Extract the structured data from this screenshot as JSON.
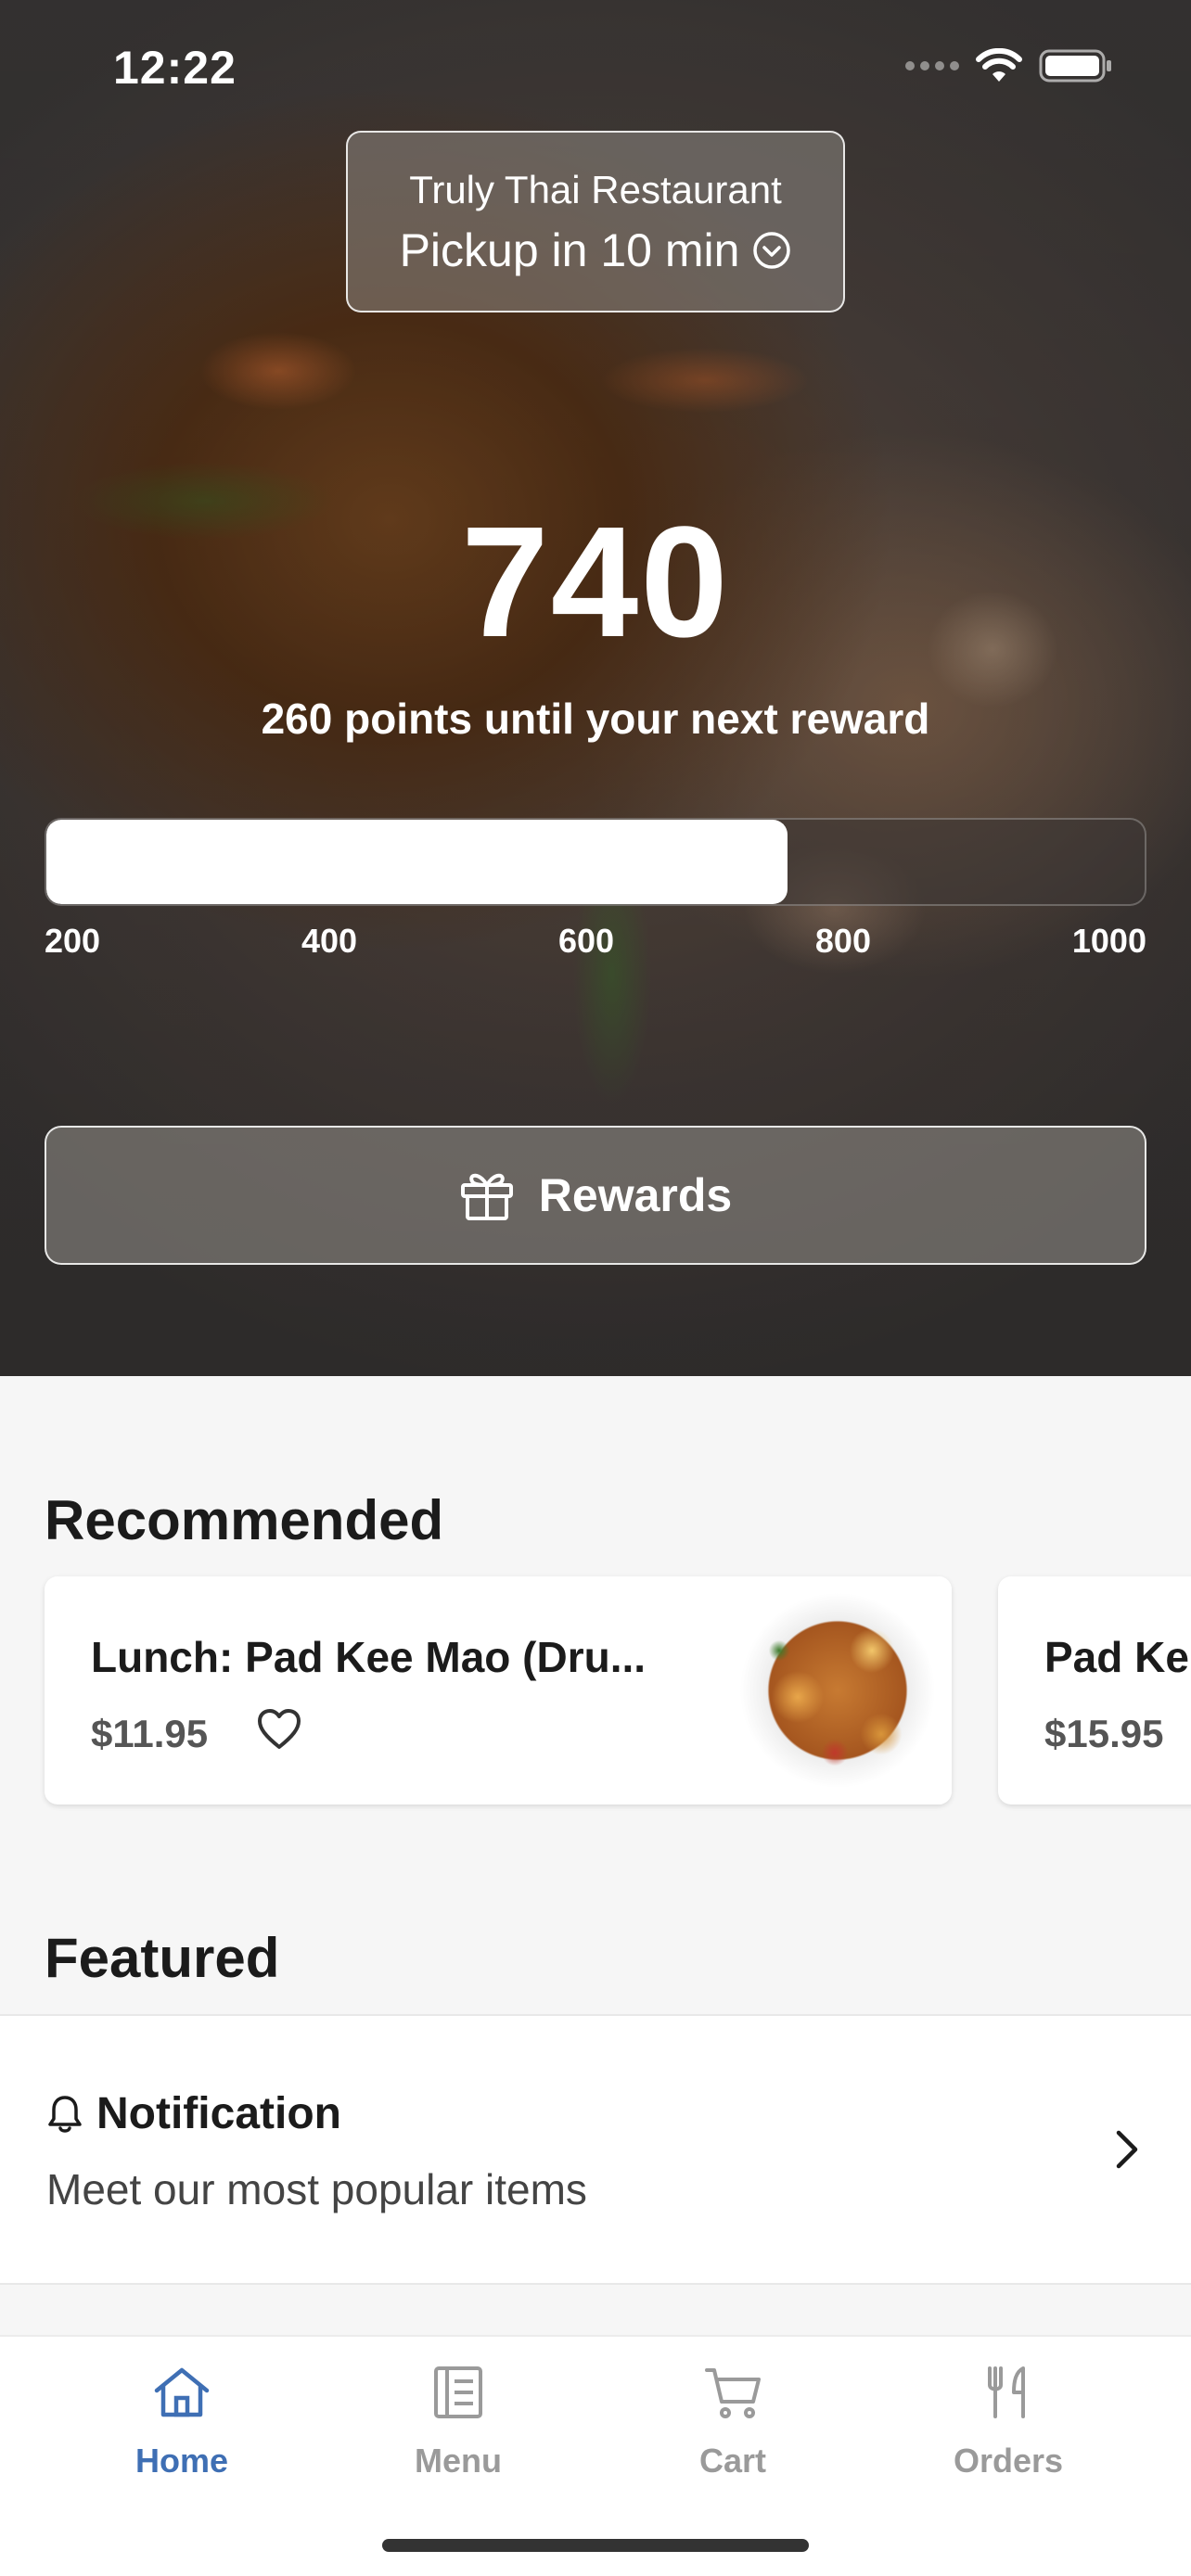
{
  "status_bar": {
    "time": "12:22"
  },
  "header": {
    "restaurant_name": "Truly Thai Restaurant",
    "pickup_text": "Pickup in 10 min"
  },
  "loyalty": {
    "points": "740",
    "points_caption": "260 points until your next reward",
    "progress_fraction": 0.675,
    "tick_labels": [
      "200",
      "400",
      "600",
      "800",
      "1000"
    ],
    "rewards_button_label": "Rewards"
  },
  "recommended": {
    "title": "Recommended",
    "items": [
      {
        "name": "Lunch: Pad Kee Mao (Dru...",
        "price": "$11.95"
      },
      {
        "name": "Pad Ke",
        "price": "$15.95"
      }
    ]
  },
  "featured": {
    "title": "Featured",
    "card": {
      "title": "Notification",
      "subtitle": "Meet our most popular items"
    }
  },
  "tabbar": {
    "tabs": [
      {
        "label": "Home",
        "icon": "home-icon"
      },
      {
        "label": "Menu",
        "icon": "menu-icon"
      },
      {
        "label": "Cart",
        "icon": "cart-icon"
      },
      {
        "label": "Orders",
        "icon": "fork-knife-icon"
      }
    ],
    "active_color": "#3f6fb4",
    "inactive_color": "#9a9a9a"
  }
}
